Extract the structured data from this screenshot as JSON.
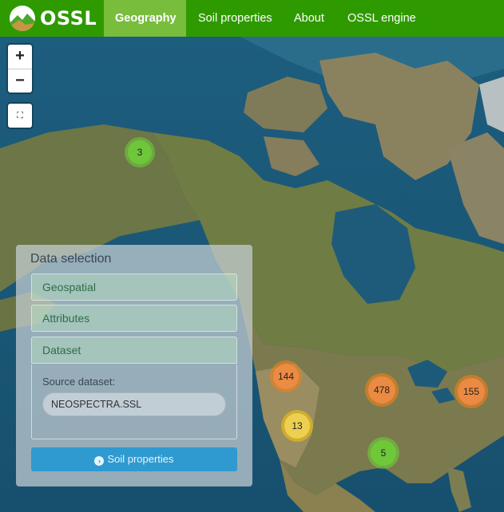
{
  "navbar": {
    "brand": "OSSL",
    "items": [
      {
        "label": "Geography",
        "active": true
      },
      {
        "label": "Soil properties",
        "active": false
      },
      {
        "label": "About",
        "active": false
      },
      {
        "label": "OSSL engine",
        "active": false
      }
    ]
  },
  "map": {
    "zoom_in": "+",
    "zoom_out": "−",
    "fullscreen_icon": "⛶",
    "clusters": [
      {
        "count": "3",
        "color": "green"
      },
      {
        "count": "144",
        "color": "orange"
      },
      {
        "count": "13",
        "color": "yellow"
      },
      {
        "count": "478",
        "color": "orange"
      },
      {
        "count": "5",
        "color": "green"
      },
      {
        "count": "155",
        "color": "orange"
      }
    ]
  },
  "panel": {
    "title": "Data selection",
    "sections": [
      "Geospatial",
      "Attributes",
      "Dataset"
    ],
    "dataset_label": "Source dataset:",
    "dataset_value": "NEOSPECTRA.SSL",
    "button_label": "Soil properties"
  },
  "colors": {
    "navbar": "#2f9a00",
    "active_tab": "#79bd3d",
    "button": "#2f9ad0",
    "ocean": "#1f5a7c",
    "land": "#6f7a45"
  }
}
